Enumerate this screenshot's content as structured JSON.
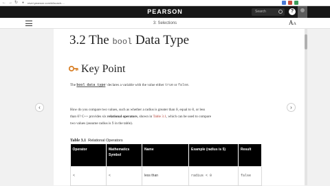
{
  "browser": {
    "url": "revel.pearson.com/#/launch-...",
    "nav": {
      "back": "←",
      "forward": "→",
      "reload": "↻"
    }
  },
  "topbar": {
    "brand": "PEARSON",
    "search_label": "Search",
    "help_label": "?"
  },
  "toc": {
    "section_title": "3: Selections",
    "font_button": "A",
    "font_button_small": "A"
  },
  "content": {
    "heading_prefix": "3.2 The ",
    "heading_code": "bool",
    "heading_suffix": " Data Type",
    "key_point": "Key Point",
    "kp_prefix": "The ",
    "kp_link": "bool data type",
    "kp_mid": " declares a variable with the value either ",
    "kp_true": "true",
    "kp_or": " or ",
    "kp_false": "false",
    "kp_end": ".",
    "p1_line1_a": "How do you compare two values, such as whether a radius is greater than ",
    "p1_zero": "0",
    "p1_line1_b": ", equal to ",
    "p1_zero2": "0",
    "p1_line1_c": ", or less",
    "p1_line2_a": "than ",
    "p1_zero3": "0",
    "p1_line2_b": "? C++ provides six ",
    "p1_bold": "relational operators",
    "p1_line2_c": ", shown in ",
    "p1_ref": "Table 3.1",
    "p1_line2_d": ", which can be used to compare",
    "p1_line3_a": "two values (assume radius is ",
    "p1_five": "5",
    "p1_line3_b": " in the table)."
  },
  "table": {
    "caption_num": "Table 3.1",
    "caption_title": "Relational Operators",
    "headers": [
      "Operator",
      "Mathematics Symbol",
      "Name",
      "Example (radius is 5)",
      "Result"
    ],
    "row1": [
      "<",
      "<",
      "less than",
      "radius < 0",
      "false"
    ]
  },
  "colors": {
    "topbar": "#171717",
    "key_icon": "#d9822b",
    "link": "#b03a2e"
  },
  "icons": {
    "search": "search-icon",
    "help": "help-icon",
    "menu": "hamburger-icon",
    "font": "font-size-icon",
    "key": "key-icon",
    "prev": "chevron-left-icon",
    "next": "chevron-right-icon"
  }
}
